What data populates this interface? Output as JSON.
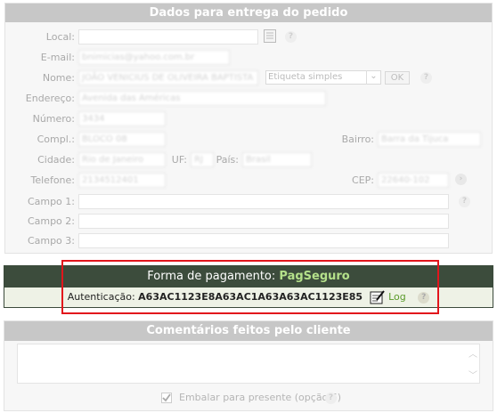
{
  "delivery": {
    "title": "Dados para entrega do pedido",
    "labels": {
      "local": "Local:",
      "email": "E-mail:",
      "nome": "Nome:",
      "endereco": "Endereço:",
      "numero": "Número:",
      "compl": "Compl.:",
      "bairro": "Bairro:",
      "cidade": "Cidade:",
      "uf": "UF:",
      "pais": "País:",
      "telefone": "Telefone:",
      "cep": "CEP:",
      "campo1": "Campo 1:",
      "campo2": "Campo 2:",
      "campo3": "Campo 3:"
    },
    "values": {
      "local": "",
      "email": "bnimicias@yahoo.com.br",
      "nome": "JOÃO VENICIUS DE OLIVEIRA BAPTISTA",
      "endereco": "Avenida das Américas",
      "numero": "3434",
      "compl": "BLOCO 08",
      "bairro": "Barra da Tijuca",
      "cidade": "Rio de Janeiro",
      "uf": "RJ",
      "pais": "Brasil",
      "telefone": "2134512401",
      "cep": "22640-102",
      "campo1": "",
      "campo2": "",
      "campo3": ""
    },
    "label_type_select": "Etiqueta simples",
    "ok_button": "OK"
  },
  "payment": {
    "title_prefix": "Forma de pagamento:",
    "gateway": "PagSeguro",
    "auth_label": "Autenticação:",
    "auth_code": "A63AC1123E8A63AC1A63A63AC1123E85",
    "log_link": "Log"
  },
  "comments": {
    "title": "Comentários feitos pelo cliente",
    "gift_wrap_label": "Embalar para presente (opção 6)",
    "gift_wrap_checked": true
  },
  "colors": {
    "payment_header": "#3c4c3c",
    "gateway": "#b4e08a",
    "highlight_box": "#e2151c",
    "log_link": "#5a9a2a"
  }
}
